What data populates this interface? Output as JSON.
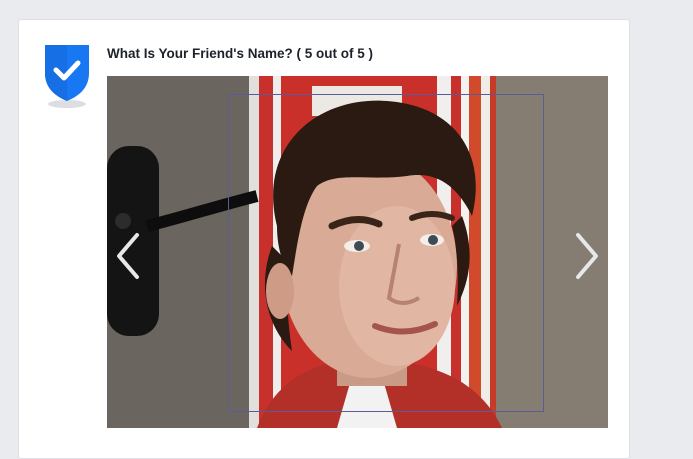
{
  "question": {
    "title": "What Is Your Friend's Name? ( 5 out of 5 )"
  },
  "icons": {
    "shield": "shield-check-icon",
    "prev": "chevron-left-icon",
    "next": "chevron-right-icon"
  },
  "colors": {
    "shield_blue": "#1877f2",
    "page_background": "#e9ebee",
    "card_border": "#dddfe2",
    "title_text": "#1d2129",
    "face_box_border": "#5b5b9a"
  },
  "photo": {
    "subject": "photo-of-friend"
  }
}
